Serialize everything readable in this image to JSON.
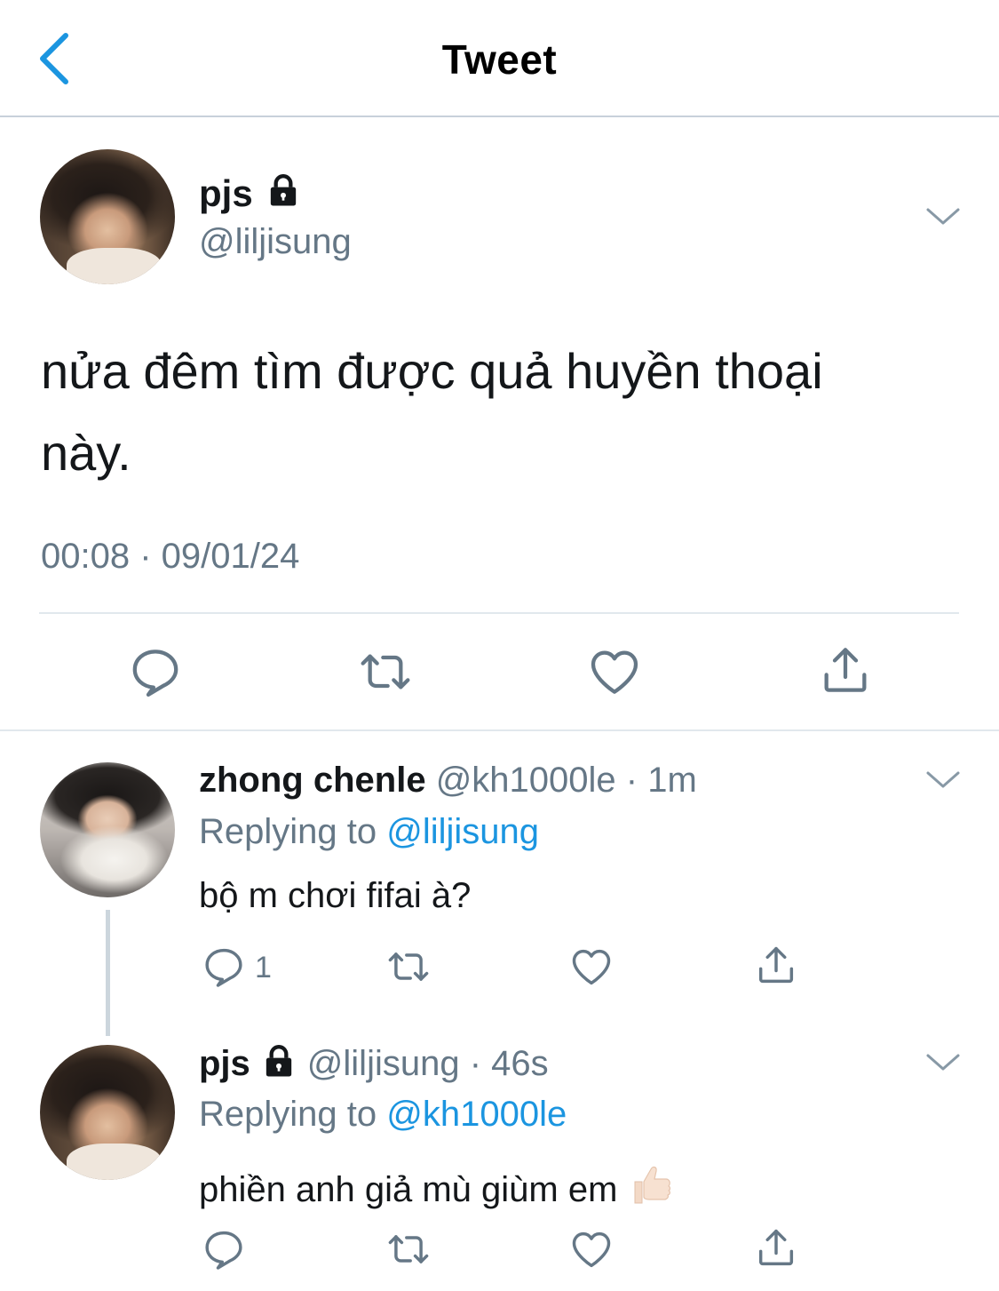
{
  "header": {
    "title": "Tweet"
  },
  "main_tweet": {
    "name": "pjs",
    "handle": "@liljisung",
    "text_line1": "nửa đêm tìm được quả huyền thoại",
    "text_line2": "này.",
    "timestamp": "00:08 · 09/01/24"
  },
  "replies": [
    {
      "name": "zhong chenle",
      "handle_time": "@kh1000le · 1m",
      "replying_label": "Replying to",
      "replying_to": "@liljisung",
      "text": "bộ m chơi fifai à?",
      "reply_count": "1"
    },
    {
      "name": "pjs",
      "handle_time": "@liljisung · 46s",
      "replying_label": "Replying to",
      "replying_to": "@kh1000le",
      "text": "phiền anh giả mù giùm em"
    }
  ],
  "icons": {
    "back": "chevron-left-icon",
    "lock": "lock-icon",
    "more": "chevron-down-icon",
    "reply": "speech-bubble-icon",
    "retweet": "retweet-icon",
    "like": "heart-icon",
    "share": "share-icon",
    "emoji": "thumbs-up-emoji"
  },
  "colors": {
    "accent": "#1b95e0",
    "secondary_text": "#657786",
    "icon": "#657786",
    "divider": "#e1e8ed"
  }
}
